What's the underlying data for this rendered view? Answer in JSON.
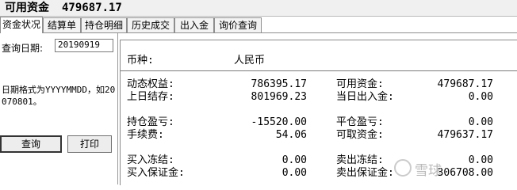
{
  "header": {
    "label": "可用资金",
    "value": "479687.17"
  },
  "tabs": [
    "资金状况",
    "结算单",
    "持仓明细",
    "历史成交",
    "出入金",
    "询价查询"
  ],
  "left": {
    "date_label": "查询日期:",
    "date_value": "20190919",
    "hint": "日期格式为YYYYMMDD，如20070801。",
    "query_button": "查询",
    "print_button": "打印"
  },
  "panel": {
    "currency_label": "币种:",
    "currency_value": "人民币",
    "rows": [
      {
        "l_label": "动态权益:",
        "l_value": "786395.17",
        "r_label": "可用资金:",
        "r_value": "479687.17"
      },
      {
        "l_label": "上日结存:",
        "l_value": "801969.23",
        "r_label": "当日出入金:",
        "r_value": "0.00"
      },
      {
        "l_label": "持仓盈亏:",
        "l_value": "-15520.00",
        "r_label": "平仓盈亏:",
        "r_value": "0.00"
      },
      {
        "l_label": "手续费:",
        "l_value": "54.06",
        "r_label": "可取资金:",
        "r_value": "479637.17"
      },
      {
        "l_label": "买入冻结:",
        "l_value": "0.00",
        "r_label": "卖出冻结:",
        "r_value": "0.00"
      },
      {
        "l_label": "买入保证金:",
        "l_value": "0.00",
        "r_label": "卖出保证金:",
        "r_value": "306708.00"
      }
    ]
  },
  "watermark": "雪球"
}
